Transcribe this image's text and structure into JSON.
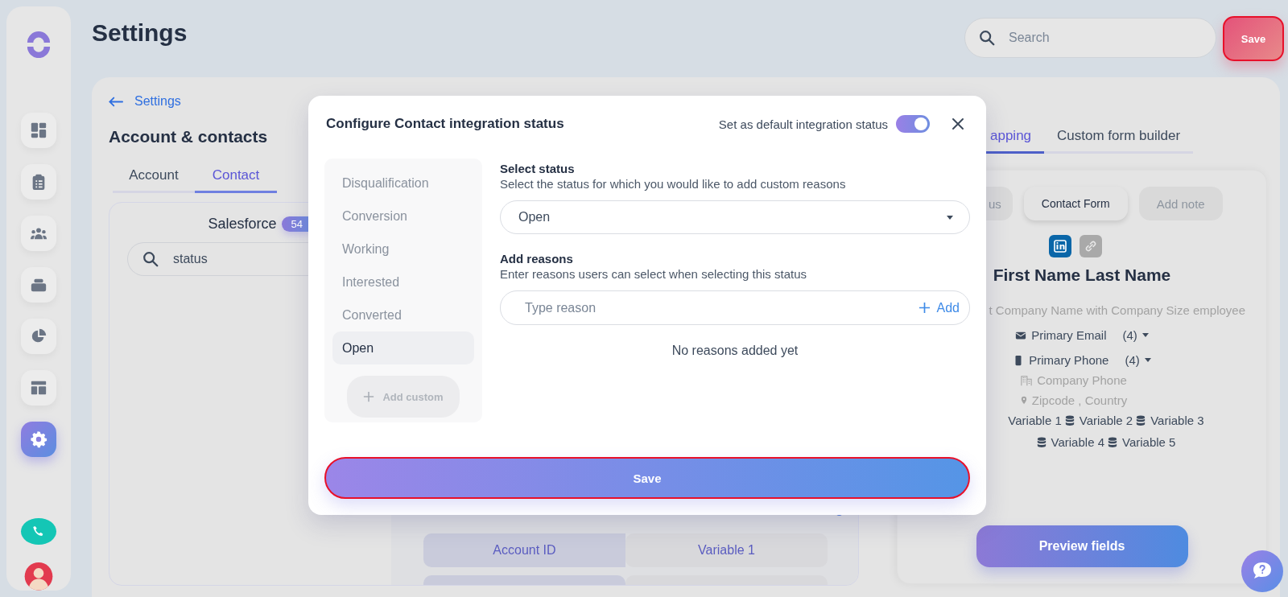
{
  "sidebar": {
    "nav": [
      {
        "kind": "dashboard",
        "selected": false
      },
      {
        "kind": "tasks",
        "selected": false
      },
      {
        "kind": "people",
        "selected": false
      },
      {
        "kind": "stack",
        "selected": false
      },
      {
        "kind": "chart",
        "selected": false
      },
      {
        "kind": "layout",
        "selected": false
      },
      {
        "kind": "settings",
        "selected": true
      }
    ]
  },
  "header": {
    "title": "Settings",
    "search": {
      "placeholder": "Search"
    },
    "save_button": "Save"
  },
  "back_link": "Settings",
  "section_title": "Account & contacts",
  "tabs": [
    {
      "label": "Account",
      "selected": false
    },
    {
      "label": "Contact",
      "selected": true
    }
  ],
  "integration": {
    "name": "Salesforce",
    "count": "54",
    "search_value": "status"
  },
  "mapping_rows": [
    {
      "column_1": "Account ID",
      "column_2": "Variable 1"
    }
  ],
  "right_tabs": [
    {
      "label": "apping",
      "selected": true
    },
    {
      "label": "Custom form builder",
      "selected": false
    }
  ],
  "preview": {
    "pills": [
      {
        "label": "us",
        "kind": "muted"
      },
      {
        "label": "Contact Form",
        "kind": "active"
      },
      {
        "label": "Add note",
        "kind": "muted"
      }
    ],
    "name": "First Name Last Name",
    "company_line": "t Company Name with Company Size employee",
    "fields": [
      {
        "kind": "email",
        "label": "Primary Email",
        "count": "(4)"
      },
      {
        "kind": "phone",
        "label": "Primary Phone",
        "count": "(4)"
      }
    ],
    "company_phone": "Company Phone",
    "location": "Zipcode , Country",
    "variables": [
      "Variable 1",
      "Variable 2",
      "Variable 3",
      "Variable 4",
      "Variable 5"
    ],
    "button": "Preview fields"
  },
  "modal": {
    "title": "Configure Contact integration status",
    "default_label": "Set as default integration status",
    "default_on": true,
    "statuses": [
      {
        "label": "Disqualification",
        "selected": false
      },
      {
        "label": "Conversion",
        "selected": false
      },
      {
        "label": "Working",
        "selected": false
      },
      {
        "label": "Interested",
        "selected": false
      },
      {
        "label": "Converted",
        "selected": false
      },
      {
        "label": "Open",
        "selected": true
      }
    ],
    "add_custom": "Add custom",
    "select_status": {
      "label": "Select status",
      "hint": "Select the status for which you would like to add custom reasons",
      "value": "Open"
    },
    "reasons": {
      "label": "Add reasons",
      "hint": "Enter reasons users can select when selecting this status",
      "placeholder": "Type reason",
      "add": "Add",
      "empty": "No reasons added yet"
    },
    "save": "Save"
  }
}
